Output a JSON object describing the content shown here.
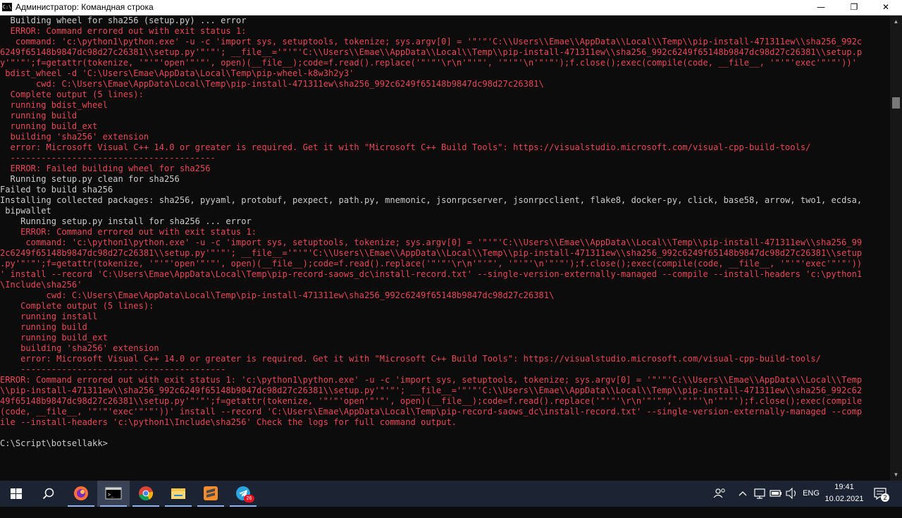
{
  "window": {
    "title": "Администратор: Командная строка",
    "icon_label": "C:\\",
    "controls": {
      "minimize": "—",
      "maximize": "❐",
      "close": "✕"
    }
  },
  "console_lines": [
    {
      "text": "  Building wheel for sha256 (setup.py) ... error",
      "color": "w"
    },
    {
      "text": "  ERROR: Command errored out with exit status 1:",
      "color": "r"
    },
    {
      "text": "   command: 'c:\\python1\\python.exe' -u -c 'import sys, setuptools, tokenize; sys.argv[0] = '\"'\"'C:\\\\Users\\\\Emae\\\\AppData\\\\Local\\\\Temp\\\\pip-install-471311ew\\\\sha256_992c",
      "color": "r"
    },
    {
      "text": "6249f65148b9847dc98d27c26381\\\\setup.py'\"'\"'; __file__='\"'\"'C:\\\\Users\\\\Emae\\\\AppData\\\\Local\\\\Temp\\\\pip-install-471311ew\\\\sha256_992c6249f65148b9847dc98d27c26381\\\\setup.p",
      "color": "r"
    },
    {
      "text": "y'\"'\"';f=getattr(tokenize, '\"'\"'open'\"'\"', open)(__file__);code=f.read().replace('\"'\"'\\r\\n'\"'\"', '\"'\"'\\n'\"'\"');f.close();exec(compile(code, __file__, '\"'\"'exec'\"'\"'))'",
      "color": "r"
    },
    {
      "text": " bdist_wheel -d 'C:\\Users\\Emae\\AppData\\Local\\Temp\\pip-wheel-k8w3h2y3'",
      "color": "r"
    },
    {
      "text": "       cwd: C:\\Users\\Emae\\AppData\\Local\\Temp\\pip-install-471311ew\\sha256_992c6249f65148b9847dc98d27c26381\\",
      "color": "r"
    },
    {
      "text": "  Complete output (5 lines):",
      "color": "r"
    },
    {
      "text": "  running bdist_wheel",
      "color": "r"
    },
    {
      "text": "  running build",
      "color": "r"
    },
    {
      "text": "  running build_ext",
      "color": "r"
    },
    {
      "text": "  building 'sha256' extension",
      "color": "r"
    },
    {
      "text": "  error: Microsoft Visual C++ 14.0 or greater is required. Get it with \"Microsoft C++ Build Tools\": https://visualstudio.microsoft.com/visual-cpp-build-tools/",
      "color": "r"
    },
    {
      "text": "  ----------------------------------------",
      "color": "r"
    },
    {
      "text": "  ERROR: Failed building wheel for sha256",
      "color": "r"
    },
    {
      "text": "  Running setup.py clean for sha256",
      "color": "w"
    },
    {
      "text": "Failed to build sha256",
      "color": "w"
    },
    {
      "text": "Installing collected packages: sha256, pyyaml, protobuf, pexpect, path.py, mnemonic, jsonrpcserver, jsonrpcclient, flake8, docker-py, click, base58, arrow, two1, ecdsa,",
      "color": "w"
    },
    {
      "text": " bipwallet",
      "color": "w"
    },
    {
      "text": "    Running setup.py install for sha256 ... error",
      "color": "w"
    },
    {
      "text": "    ERROR: Command errored out with exit status 1:",
      "color": "r"
    },
    {
      "text": "     command: 'c:\\python1\\python.exe' -u -c 'import sys, setuptools, tokenize; sys.argv[0] = '\"'\"'C:\\\\Users\\\\Emae\\\\AppData\\\\Local\\\\Temp\\\\pip-install-471311ew\\\\sha256_99",
      "color": "r"
    },
    {
      "text": "2c6249f65148b9847dc98d27c26381\\\\setup.py'\"'\"'; __file__='\"'\"'C:\\\\Users\\\\Emae\\\\AppData\\\\Local\\\\Temp\\\\pip-install-471311ew\\\\sha256_992c6249f65148b9847dc98d27c26381\\\\setup",
      "color": "r"
    },
    {
      "text": ".py'\"'\"';f=getattr(tokenize, '\"'\"'open'\"'\"', open)(__file__);code=f.read().replace('\"'\"'\\r\\n'\"'\"', '\"'\"'\\n'\"'\"');f.close();exec(compile(code, __file__, '\"'\"'exec'\"'\"'))",
      "color": "r"
    },
    {
      "text": "' install --record 'C:\\Users\\Emae\\AppData\\Local\\Temp\\pip-record-saows_dc\\install-record.txt' --single-version-externally-managed --compile --install-headers 'c:\\python1",
      "color": "r"
    },
    {
      "text": "\\Include\\sha256'",
      "color": "r"
    },
    {
      "text": "         cwd: C:\\Users\\Emae\\AppData\\Local\\Temp\\pip-install-471311ew\\sha256_992c6249f65148b9847dc98d27c26381\\",
      "color": "r"
    },
    {
      "text": "    Complete output (5 lines):",
      "color": "r"
    },
    {
      "text": "    running install",
      "color": "r"
    },
    {
      "text": "    running build",
      "color": "r"
    },
    {
      "text": "    running build_ext",
      "color": "r"
    },
    {
      "text": "    building 'sha256' extension",
      "color": "r"
    },
    {
      "text": "    error: Microsoft Visual C++ 14.0 or greater is required. Get it with \"Microsoft C++ Build Tools\": https://visualstudio.microsoft.com/visual-cpp-build-tools/",
      "color": "r"
    },
    {
      "text": "    ----------------------------------------",
      "color": "r"
    },
    {
      "text": "ERROR: Command errored out with exit status 1: 'c:\\python1\\python.exe' -u -c 'import sys, setuptools, tokenize; sys.argv[0] = '\"'\"'C:\\\\Users\\\\Emae\\\\AppData\\\\Local\\\\Temp",
      "color": "r"
    },
    {
      "text": "\\\\pip-install-471311ew\\\\sha256_992c6249f65148b9847dc98d27c26381\\\\setup.py'\"'\"'; __file__='\"'\"'C:\\\\Users\\\\Emae\\\\AppData\\\\Local\\\\Temp\\\\pip-install-471311ew\\\\sha256_992c62",
      "color": "r"
    },
    {
      "text": "49f65148b9847dc98d27c26381\\\\setup.py'\"'\"';f=getattr(tokenize, '\"'\"'open'\"'\"', open)(__file__);code=f.read().replace('\"'\"'\\r\\n'\"'\"', '\"'\"'\\n'\"'\"');f.close();exec(compile",
      "color": "r"
    },
    {
      "text": "(code, __file__, '\"'\"'exec'\"'\"'))' install --record 'C:\\Users\\Emae\\AppData\\Local\\Temp\\pip-record-saows_dc\\install-record.txt' --single-version-externally-managed --comp",
      "color": "r"
    },
    {
      "text": "ile --install-headers 'c:\\python1\\Include\\sha256' Check the logs for full command output.",
      "color": "r"
    },
    {
      "text": "",
      "color": "w"
    },
    {
      "text": "C:\\Script\\botsellakk>",
      "color": "w"
    }
  ],
  "colors": {
    "console_bg": "#0c0c0c",
    "text_white": "#cccccc",
    "text_red": "#e74856",
    "taskbar_bg": "#1c2333"
  },
  "taskbar": {
    "apps": [
      {
        "name": "start",
        "icon": "windows-logo-icon"
      },
      {
        "name": "search",
        "icon": "search-icon"
      },
      {
        "name": "firefox",
        "icon": "firefox-icon"
      },
      {
        "name": "cmd",
        "icon": "terminal-icon",
        "active": true
      },
      {
        "name": "chrome",
        "icon": "chrome-icon"
      },
      {
        "name": "explorer",
        "icon": "folder-icon"
      },
      {
        "name": "sublime",
        "icon": "sublime-icon"
      },
      {
        "name": "telegram",
        "icon": "telegram-icon",
        "badge": "26"
      }
    ],
    "tray": {
      "language": "ENG",
      "time": "19:41",
      "date": "10.02.2021",
      "notifications_badge": "2"
    }
  }
}
